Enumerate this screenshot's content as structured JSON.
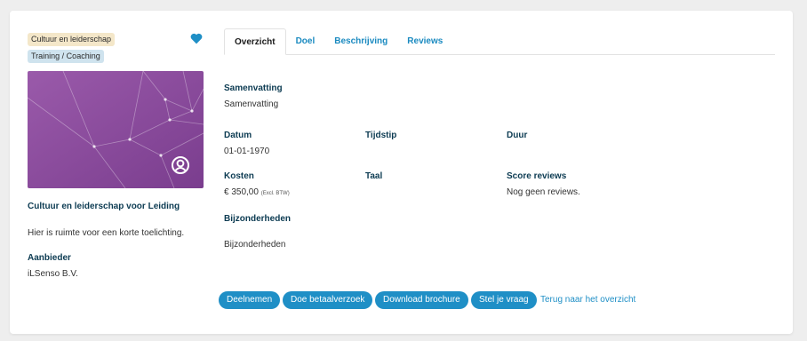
{
  "sidebar": {
    "tags": [
      "Cultuur en leiderschap",
      "Training / Coaching"
    ],
    "title": "Cultuur en leiderschap voor Leiding",
    "description": "Hier is ruimte voor een korte toelichting.",
    "provider_label": "Aanbieder",
    "provider_value": "iLSenso B.V.",
    "heart_icon": "heart-icon",
    "hero_image_icon": "brand-logo-icon"
  },
  "tabs": [
    {
      "label": "Overzicht",
      "active": true
    },
    {
      "label": "Doel",
      "active": false
    },
    {
      "label": "Beschrijving",
      "active": false
    },
    {
      "label": "Reviews",
      "active": false
    }
  ],
  "details": {
    "summary_label": "Samenvatting",
    "summary_value": "Samenvatting",
    "date_label": "Datum",
    "date_value": "01-01-1970",
    "time_label": "Tijdstip",
    "duration_label": "Duur",
    "cost_label": "Kosten",
    "cost_value": "€ 350,00",
    "cost_note": "(Excl. BTW)",
    "language_label": "Taal",
    "score_label": "Score reviews",
    "score_value": "Nog geen reviews.",
    "particulars_label": "Bijzonderheden",
    "particulars_value": "Bijzonderheden"
  },
  "actions": {
    "join": "Deelnemen",
    "payment_request": "Doe betaalverzoek",
    "download": "Download brochure",
    "ask": "Stel je vraag",
    "back": "Terug naar het overzicht"
  },
  "colors": {
    "accent": "#1f8fc6",
    "heading": "#0c3b52",
    "hero_purple": "#8a4a9c",
    "tag_beige": "#f4e7c9",
    "tag_blue": "#cfe3ee"
  }
}
